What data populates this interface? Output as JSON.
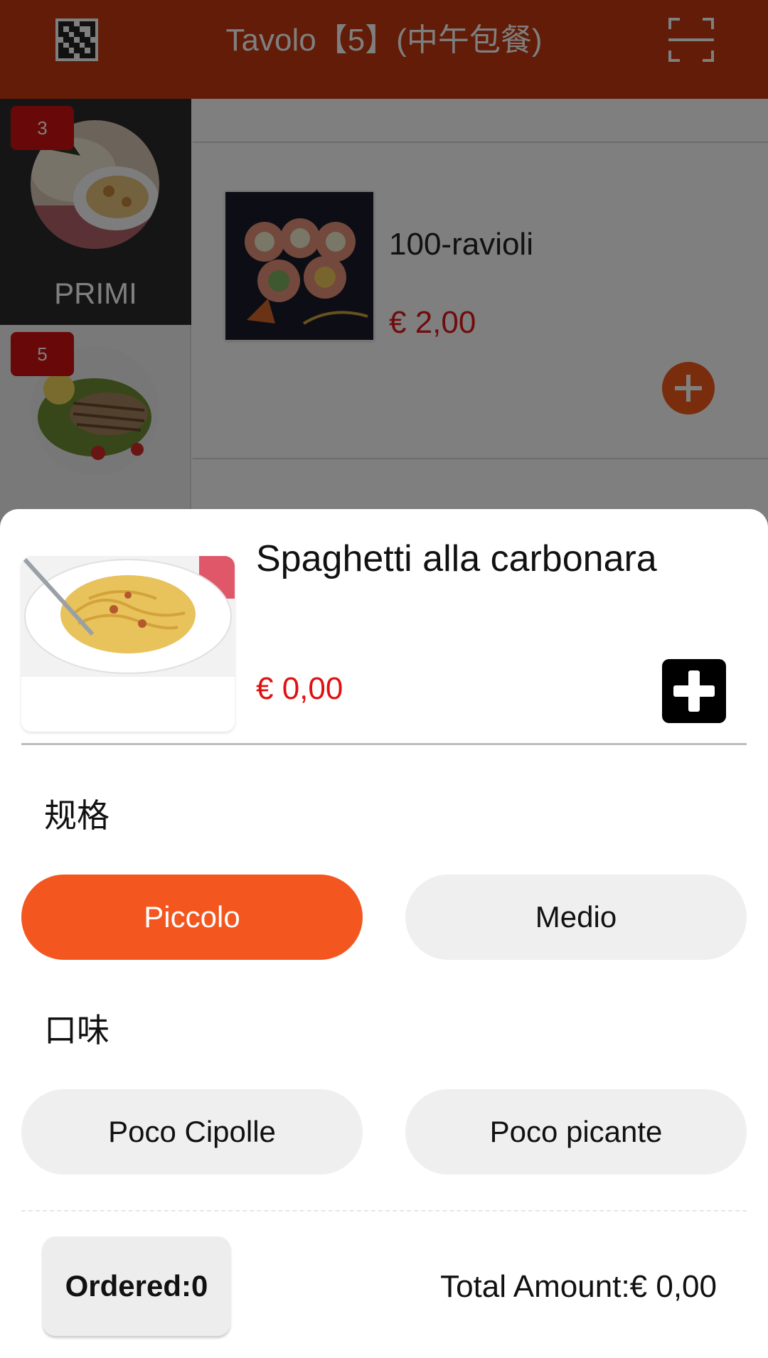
{
  "header": {
    "title": "Tavolo【5】(中午包餐)",
    "qr_icon": "qr-code-icon",
    "scan_icon": "scan-icon"
  },
  "sidebar": {
    "categories": [
      {
        "label": "PRIMI",
        "badge": "3",
        "active": true
      },
      {
        "label": "",
        "badge": "5",
        "active": false
      }
    ]
  },
  "list": {
    "items": [
      {
        "name": "100-ravioli",
        "price": "€ 2,00"
      }
    ]
  },
  "sheet": {
    "dish_name": "Spaghetti alla carbonara",
    "dish_price": "€ 0,00",
    "groups": [
      {
        "title": "规格",
        "options": [
          {
            "label": "Piccolo",
            "selected": true
          },
          {
            "label": "Medio",
            "selected": false
          }
        ]
      },
      {
        "title": "口味",
        "options": [
          {
            "label": "Poco Cipolle",
            "selected": false
          },
          {
            "label": "Poco picante",
            "selected": false
          }
        ]
      }
    ],
    "ordered": "Ordered:0",
    "total": "Total Amount:€ 0,00"
  },
  "colors": {
    "header": "#c4380f",
    "accent": "#f45620",
    "price": "#e01010"
  }
}
